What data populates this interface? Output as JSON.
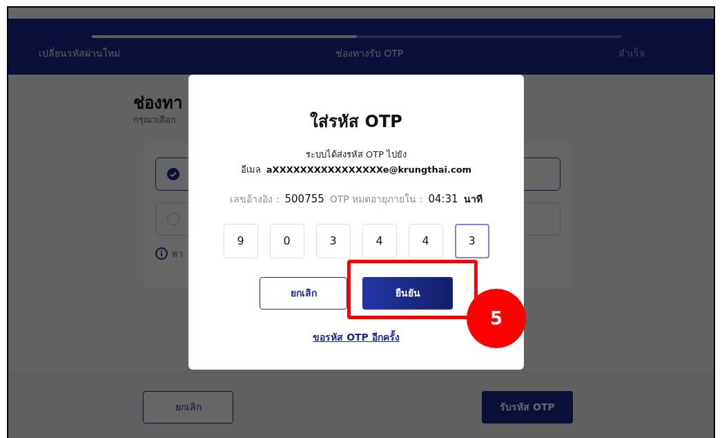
{
  "stepper": {
    "level": 0.5,
    "steps": [
      {
        "label": "เปลี่ยนรหัสผ่านใหม่",
        "reached": true
      },
      {
        "label": "ช่องทางรับ OTP",
        "reached": true
      },
      {
        "label": "สำเร็จ",
        "reached": false
      }
    ]
  },
  "page": {
    "heading": "ช่องทา",
    "subtitle": "กรุณาเลือก",
    "options": [
      {
        "checked": true
      },
      {
        "checked": false
      }
    ],
    "info": "หา"
  },
  "footer": {
    "cancel": "ยกเลิก",
    "submit": "รับรหัส OTP"
  },
  "dialog": {
    "title": "ใส่รหัส OTP",
    "message": "ระบบได้ส่งรหัส OTP ไปยัง",
    "email_label": "อีเมล",
    "email": "aXXXXXXXXXXXXXXXXe@krungthai.com",
    "ref_label": "เลขอ้างอิง :",
    "ref": "500755",
    "expiry_label": "OTP หมดอายุภายใน :",
    "expiry": "04:31",
    "expiry_unit": "นาที",
    "digits": [
      {
        "value": "9",
        "focused": false
      },
      {
        "value": "0",
        "focused": false
      },
      {
        "value": "3",
        "focused": false
      },
      {
        "value": "4",
        "focused": false
      },
      {
        "value": "4",
        "focused": false
      },
      {
        "value": "3",
        "focused": true
      }
    ],
    "cancel": "ยกเลิก",
    "confirm": "ยืนยัน",
    "resend": "ขอรหัส OTP อีกครั้ง"
  },
  "annotation": {
    "step": "5"
  }
}
